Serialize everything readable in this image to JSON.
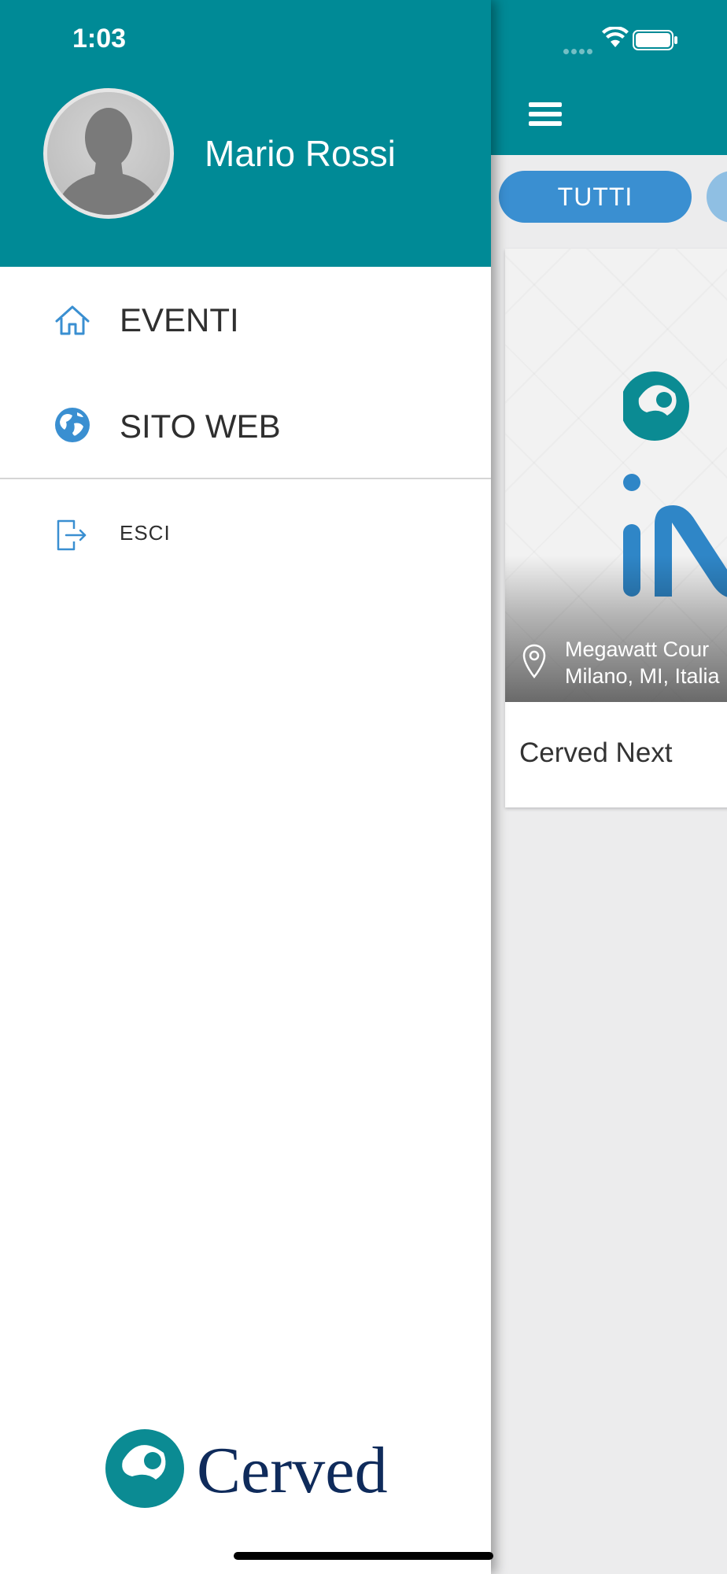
{
  "status_bar": {
    "time": "1:03"
  },
  "drawer": {
    "user": {
      "name": "Mario Rossi"
    },
    "menu": [
      {
        "label": "EVENTI",
        "icon": "home-icon"
      },
      {
        "label": "SITO WEB",
        "icon": "globe-icon"
      },
      {
        "label": "ESCI",
        "icon": "logout-icon"
      }
    ],
    "brand": {
      "name": "Cerved"
    }
  },
  "main": {
    "filters": [
      {
        "label": "TUTTI",
        "selected": true
      }
    ],
    "event_card": {
      "location_line1": "Megawatt Cour",
      "location_line2": "Milano, MI, Italia",
      "title": "Cerved Next"
    }
  },
  "colors": {
    "header_teal": "#008a96",
    "chip_blue": "#3a8fd1",
    "icon_blue": "#3a8fd1",
    "brand_navy": "#0f2b5b",
    "brand_teal": "#0b8b93"
  }
}
